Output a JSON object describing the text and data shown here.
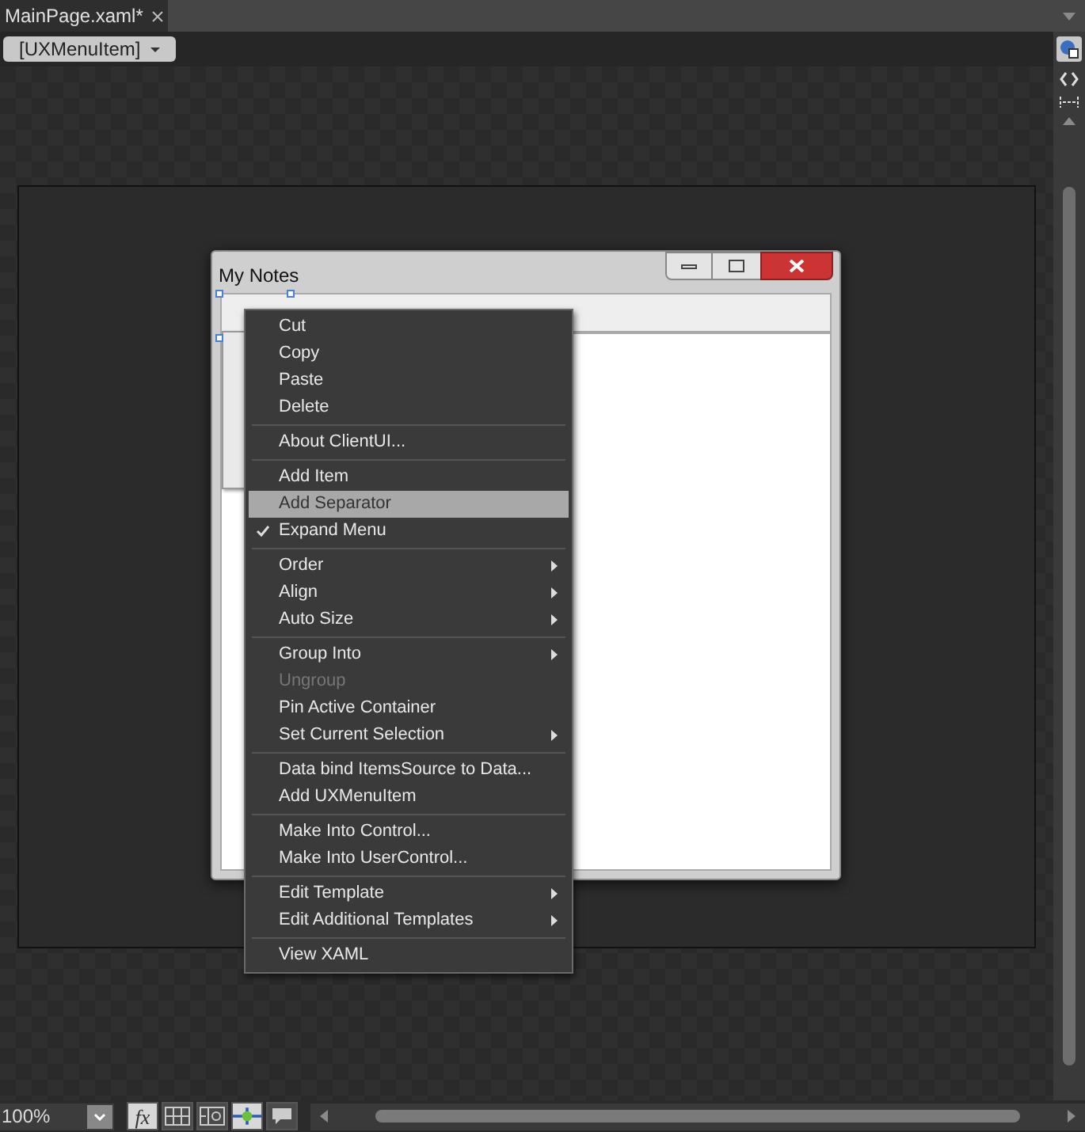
{
  "document_tab": {
    "label": "MainPage.xaml*",
    "selected": true
  },
  "breadcrumb": {
    "label": "[UXMenuItem]"
  },
  "window": {
    "title": "My Notes"
  },
  "context_menu": [
    {
      "kind": "item",
      "label": "Cut",
      "checked": false,
      "disabled": false,
      "submenu": false,
      "selected": false
    },
    {
      "kind": "item",
      "label": "Copy",
      "checked": false,
      "disabled": false,
      "submenu": false,
      "selected": false
    },
    {
      "kind": "item",
      "label": "Paste",
      "checked": false,
      "disabled": false,
      "submenu": false,
      "selected": false
    },
    {
      "kind": "item",
      "label": "Delete",
      "checked": false,
      "disabled": false,
      "submenu": false,
      "selected": false
    },
    {
      "kind": "separator"
    },
    {
      "kind": "item",
      "label": "About ClientUI...",
      "checked": false,
      "disabled": false,
      "submenu": false,
      "selected": false
    },
    {
      "kind": "separator"
    },
    {
      "kind": "item",
      "label": "Add Item",
      "checked": false,
      "disabled": false,
      "submenu": false,
      "selected": false
    },
    {
      "kind": "item",
      "label": "Add Separator",
      "checked": false,
      "disabled": false,
      "submenu": false,
      "selected": true
    },
    {
      "kind": "item",
      "label": "Expand Menu",
      "checked": true,
      "disabled": false,
      "submenu": false,
      "selected": false
    },
    {
      "kind": "separator"
    },
    {
      "kind": "item",
      "label": "Order",
      "checked": false,
      "disabled": false,
      "submenu": true,
      "selected": false
    },
    {
      "kind": "item",
      "label": "Align",
      "checked": false,
      "disabled": false,
      "submenu": true,
      "selected": false
    },
    {
      "kind": "item",
      "label": "Auto Size",
      "checked": false,
      "disabled": false,
      "submenu": true,
      "selected": false
    },
    {
      "kind": "separator"
    },
    {
      "kind": "item",
      "label": "Group Into",
      "checked": false,
      "disabled": false,
      "submenu": true,
      "selected": false
    },
    {
      "kind": "item",
      "label": "Ungroup",
      "checked": false,
      "disabled": true,
      "submenu": false,
      "selected": false
    },
    {
      "kind": "item",
      "label": "Pin Active Container",
      "checked": false,
      "disabled": false,
      "submenu": false,
      "selected": false
    },
    {
      "kind": "item",
      "label": "Set Current Selection",
      "checked": false,
      "disabled": false,
      "submenu": true,
      "selected": false
    },
    {
      "kind": "separator"
    },
    {
      "kind": "item",
      "label": "Data bind ItemsSource to Data...",
      "checked": false,
      "disabled": false,
      "submenu": false,
      "selected": false
    },
    {
      "kind": "item",
      "label": "Add UXMenuItem",
      "checked": false,
      "disabled": false,
      "submenu": false,
      "selected": false
    },
    {
      "kind": "separator"
    },
    {
      "kind": "item",
      "label": "Make Into Control...",
      "checked": false,
      "disabled": false,
      "submenu": false,
      "selected": false
    },
    {
      "kind": "item",
      "label": "Make Into UserControl...",
      "checked": false,
      "disabled": false,
      "submenu": false,
      "selected": false
    },
    {
      "kind": "separator"
    },
    {
      "kind": "item",
      "label": "Edit Template",
      "checked": false,
      "disabled": false,
      "submenu": true,
      "selected": false
    },
    {
      "kind": "item",
      "label": "Edit Additional Templates",
      "checked": false,
      "disabled": false,
      "submenu": true,
      "selected": false
    },
    {
      "kind": "separator"
    },
    {
      "kind": "item",
      "label": "View XAML",
      "checked": false,
      "disabled": false,
      "submenu": false,
      "selected": false
    }
  ],
  "zoom": {
    "value": "100%"
  },
  "bottom_toolbar": [
    {
      "kind": "fx",
      "label": "fx",
      "selected": true
    },
    {
      "kind": "grid",
      "selected": false
    },
    {
      "kind": "grid-snap",
      "selected": false
    },
    {
      "kind": "snap",
      "selected": true
    },
    {
      "kind": "annotation",
      "selected": false
    }
  ]
}
